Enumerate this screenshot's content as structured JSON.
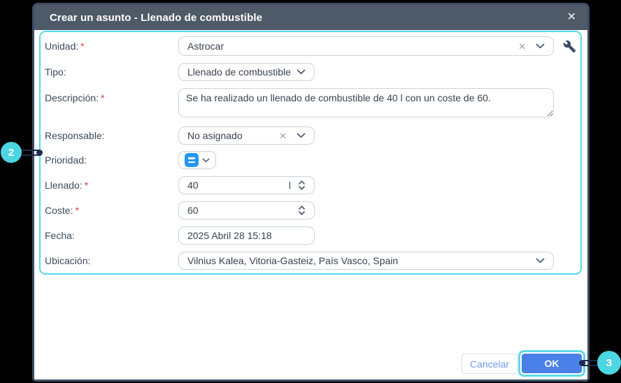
{
  "dialog": {
    "title": "Crear un asunto - Llenado de combustible"
  },
  "icons": {
    "close": "✕",
    "clear": "✕"
  },
  "form": {
    "required_marker": "*",
    "unidad": {
      "label": "Unidad:",
      "value": "Astrocar"
    },
    "tipo": {
      "label": "Tipo:",
      "value": "Llenado de combustible"
    },
    "descripcion": {
      "label": "Descripción:",
      "value": "Se ha realizado un llenado de combustible de 40 l con un coste de 60."
    },
    "responsable": {
      "label": "Responsable:",
      "value": "No asignado"
    },
    "prioridad": {
      "label": "Prioridad:"
    },
    "llenado": {
      "label": "Llenado:",
      "value": "40",
      "unit": "l"
    },
    "coste": {
      "label": "Coste:",
      "value": "60"
    },
    "fecha": {
      "label": "Fecha:",
      "value": "2025 Abril 28 15:18"
    },
    "ubicacion": {
      "label": "Ubicación:",
      "value": "Vilnius Kalea, Vitoria-Gasteiz, País Vasco, Spain"
    }
  },
  "footer": {
    "cancel_label": "Cancelar",
    "ok_label": "OK"
  },
  "callouts": {
    "step_2": "2",
    "step_3": "3"
  },
  "colors": {
    "titlebar": "#4e5a68",
    "highlight_teal": "#55d8e8",
    "callout_teal": "#4cd6e2",
    "primary_blue": "#4a80e8",
    "priority_blue": "#2596f3",
    "required_red": "#e03c31"
  }
}
